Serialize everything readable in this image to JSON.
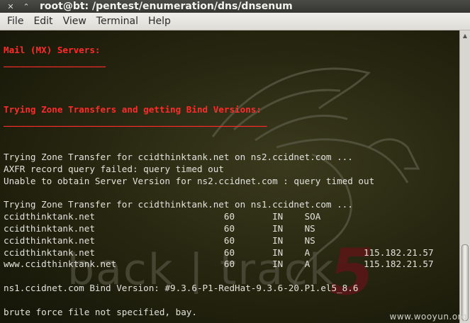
{
  "window": {
    "title": "root@bt: /pentest/enumeration/dns/dnsenum",
    "close_glyph": "✕",
    "minimize_glyph": "⌃"
  },
  "menu": [
    "File",
    "Edit",
    "View",
    "Terminal",
    "Help"
  ],
  "terminal": {
    "lines": [
      {
        "text": "Mail (MX) Servers:",
        "style": "red"
      },
      {
        "text": "___________________",
        "style": "red"
      },
      {
        "text": "",
        "style": ""
      },
      {
        "text": "",
        "style": ""
      },
      {
        "text": "",
        "style": ""
      },
      {
        "text": "Trying Zone Transfers and getting Bind Versions:",
        "style": "red"
      },
      {
        "text": "_________________________________________________",
        "style": "red"
      },
      {
        "text": "",
        "style": ""
      },
      {
        "text": "",
        "style": ""
      },
      {
        "text": "Trying Zone Transfer for ccidthinktank.net on ns2.ccidnet.com ...",
        "style": ""
      },
      {
        "text": "AXFR record query failed: query timed out",
        "style": ""
      },
      {
        "text": "Unable to obtain Server Version for ns2.ccidnet.com : query timed out",
        "style": ""
      },
      {
        "text": "",
        "style": ""
      },
      {
        "text": "Trying Zone Transfer for ccidthinktank.net on ns1.ccidnet.com ...",
        "style": ""
      },
      {
        "text": "ccidthinktank.net                        60       IN    SOA",
        "style": ""
      },
      {
        "text": "ccidthinktank.net                        60       IN    NS",
        "style": ""
      },
      {
        "text": "ccidthinktank.net                        60       IN    NS",
        "style": ""
      },
      {
        "text": "ccidthinktank.net                        60       IN    A          115.182.21.57",
        "style": ""
      },
      {
        "text": "www.ccidthinktank.net                    60       IN    A          115.182.21.57",
        "style": ""
      },
      {
        "text": "",
        "style": ""
      },
      {
        "text": "ns1.ccidnet.com Bind Version: #9.3.6-P1-RedHat-9.3.6-20.P1.el5_8.6",
        "style": ""
      },
      {
        "text": "",
        "style": ""
      },
      {
        "text": "brute force file not specified, bay.",
        "style": ""
      }
    ],
    "background_logo_text": "back | track",
    "background_logo_number": "5"
  },
  "watermark": "www.wooyun.org",
  "colors": {
    "heading_red": "#ff2b2b",
    "text": "#e2e2dc"
  }
}
